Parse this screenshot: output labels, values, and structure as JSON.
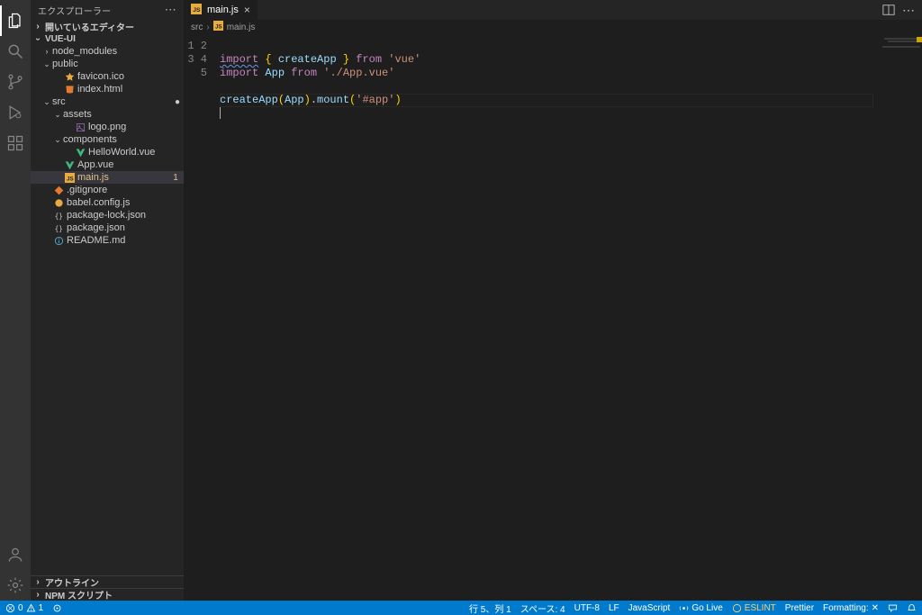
{
  "activity": {
    "items": [
      "explorer",
      "search",
      "source-control",
      "run-debug",
      "extensions"
    ],
    "bottom": [
      "account",
      "settings"
    ]
  },
  "sidebar": {
    "title": "エクスプローラー",
    "sections": {
      "open_editors": "開いているエディター",
      "outline": "アウトライン",
      "npm_scripts": "NPM スクリプト"
    },
    "project": {
      "name": "VUE-UI",
      "modified": true
    },
    "tree": [
      {
        "kind": "folder",
        "name": "node_modules",
        "depth": 1,
        "open": false
      },
      {
        "kind": "folder",
        "name": "public",
        "depth": 1,
        "open": true
      },
      {
        "kind": "file",
        "name": "favicon.ico",
        "depth": 2,
        "icon": "star",
        "color": "c-yellow"
      },
      {
        "kind": "file",
        "name": "index.html",
        "depth": 2,
        "icon": "html",
        "color": "c-orange"
      },
      {
        "kind": "folder",
        "name": "src",
        "depth": 1,
        "open": true,
        "modified": true
      },
      {
        "kind": "folder",
        "name": "assets",
        "depth": 2,
        "open": true
      },
      {
        "kind": "file",
        "name": "logo.png",
        "depth": 3,
        "icon": "image",
        "color": "c-purple"
      },
      {
        "kind": "folder",
        "name": "components",
        "depth": 2,
        "open": true
      },
      {
        "kind": "file",
        "name": "HelloWorld.vue",
        "depth": 3,
        "icon": "vue",
        "color": "c-green"
      },
      {
        "kind": "file",
        "name": "App.vue",
        "depth": 2,
        "icon": "vue",
        "color": "c-green"
      },
      {
        "kind": "file",
        "name": "main.js",
        "depth": 2,
        "icon": "js",
        "color": "c-yellow",
        "selected": true,
        "badge": "1"
      },
      {
        "kind": "file",
        "name": ".gitignore",
        "depth": 1,
        "icon": "git",
        "color": "c-orange"
      },
      {
        "kind": "file",
        "name": "babel.config.js",
        "depth": 1,
        "icon": "babel",
        "color": "c-yellow"
      },
      {
        "kind": "file",
        "name": "package-lock.json",
        "depth": 1,
        "icon": "json",
        "color": "c-grey"
      },
      {
        "kind": "file",
        "name": "package.json",
        "depth": 1,
        "icon": "json",
        "color": "c-grey"
      },
      {
        "kind": "file",
        "name": "README.md",
        "depth": 1,
        "icon": "info",
        "color": "c-blue"
      }
    ]
  },
  "tabs": {
    "open": [
      {
        "label": "main.js",
        "icon": "js"
      }
    ]
  },
  "breadcrumb": {
    "parts": [
      "src",
      "main.js"
    ],
    "icon": "js"
  },
  "editor": {
    "lines": [
      "1",
      "2",
      "3",
      "4",
      "5"
    ]
  },
  "status": {
    "errors": "0",
    "warnings": "1",
    "port_icon": true,
    "cursor": "行 5、列 1",
    "spaces": "スペース: 4",
    "encoding": "UTF-8",
    "eol": "LF",
    "language": "JavaScript",
    "golive": "Go Live",
    "eslint": "ESLINT",
    "prettier": "Prettier",
    "formatting": "Formatting:",
    "feedback": true,
    "bell": true
  }
}
